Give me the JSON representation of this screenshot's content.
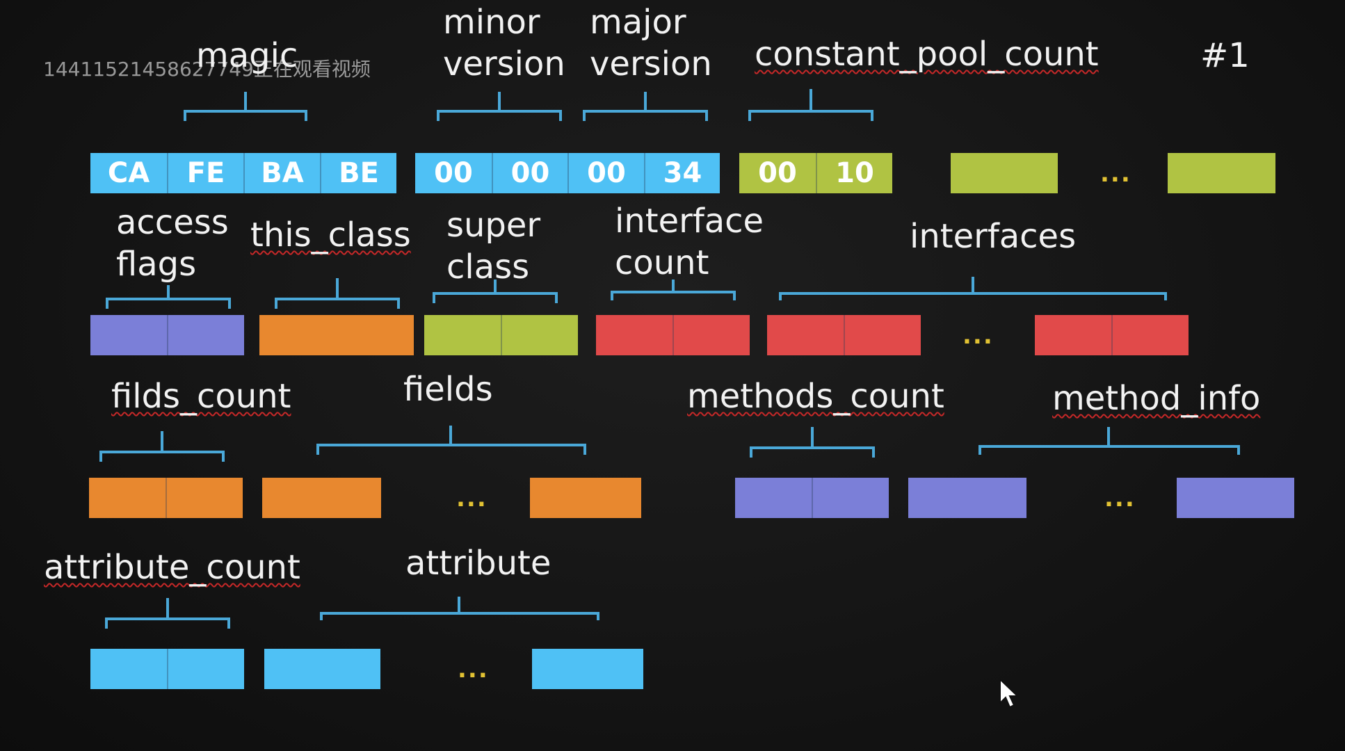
{
  "watermark": "14411521458627749正在观看视频",
  "colors": {
    "blue": "#4fc1f5",
    "green": "#b0c343",
    "purple": "#7b7fd8",
    "orange": "#e8882f",
    "red": "#e14a4a",
    "brace": "#4aa8d8",
    "dots": "#e2c233"
  },
  "labels": {
    "magic": "magic",
    "minor_version": "minor\nversion",
    "major_version": "major\nversion",
    "constant_pool_count": "constant_pool_count",
    "pool_index": "#1",
    "access_flags": "access\nflags",
    "this_class": "this_class",
    "super_class": "super\nclass",
    "interface_count": "interface\ncount",
    "interfaces": "interfaces",
    "fields_count": "filds_count",
    "fields": "fields",
    "methods_count": "methods_count",
    "method_info": "method_info",
    "attribute_count": "attribute_count",
    "attribute": "attribute"
  },
  "bytes": {
    "magic": [
      "CA",
      "FE",
      "BA",
      "BE"
    ],
    "minor_version": [
      "00",
      "00"
    ],
    "major_version": [
      "00",
      "34"
    ],
    "constant_pool_count": [
      "00",
      "10"
    ]
  },
  "ellipsis": "..."
}
